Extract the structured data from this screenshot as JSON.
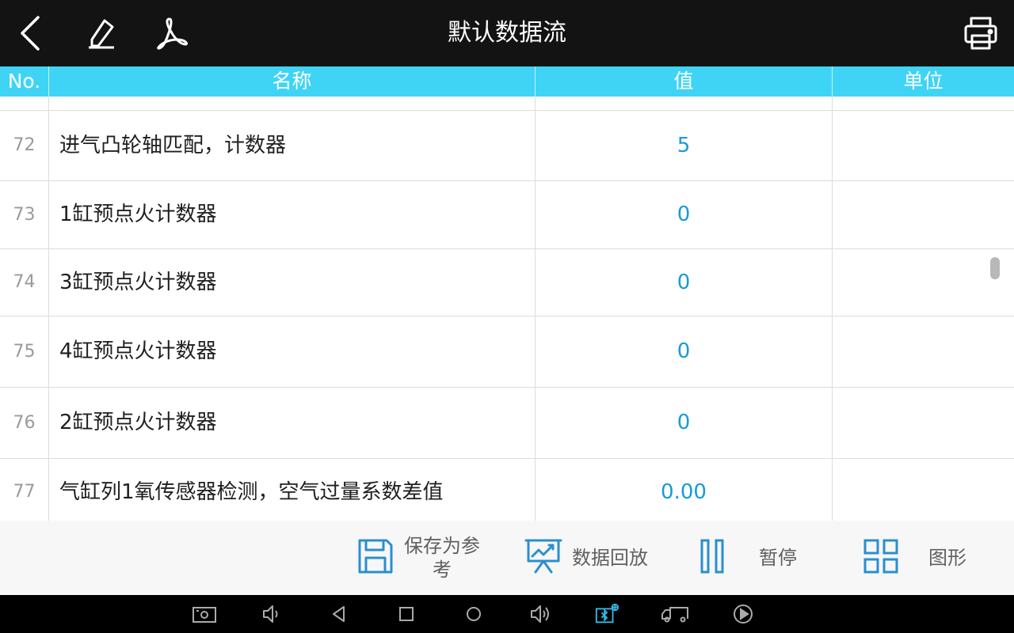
{
  "topbar": {
    "title": "默认数据流",
    "icons": [
      "back-arrow-icon",
      "pencil-icon",
      "pdf-icon",
      "printer-icon"
    ]
  },
  "table": {
    "headers": {
      "no": "No.",
      "name": "名称",
      "value": "值",
      "unit": "单位"
    },
    "rows": [
      {
        "no": "72",
        "name": "进气凸轮轴匹配，计数器",
        "value": "5",
        "unit": ""
      },
      {
        "no": "73",
        "name": "1缸预点火计数器",
        "value": "0",
        "unit": ""
      },
      {
        "no": "74",
        "name": "3缸预点火计数器",
        "value": "0",
        "unit": ""
      },
      {
        "no": "75",
        "name": "4缸预点火计数器",
        "value": "0",
        "unit": ""
      },
      {
        "no": "76",
        "name": "2缸预点火计数器",
        "value": "0",
        "unit": ""
      },
      {
        "no": "77",
        "name": "气缸列1氧传感器检测，空气过量系数差值",
        "value": "0.00",
        "unit": ""
      }
    ]
  },
  "actions": {
    "save_line1": "保存为参",
    "save_line2": "考",
    "playback": "数据回放",
    "pause": "暂停",
    "graph": "图形"
  },
  "colors": {
    "header_bg": "#3fd4f5",
    "value_text": "#1a9ad6",
    "action_icon": "#2a8fcf",
    "topbar_bg": "#131313"
  },
  "navbar": {
    "icons": [
      "screenshot-icon",
      "volume-down-icon",
      "back-icon",
      "recents-icon",
      "home-icon",
      "volume-up-icon",
      "bluetooth-vci-icon",
      "truck-icon",
      "play-icon"
    ]
  }
}
